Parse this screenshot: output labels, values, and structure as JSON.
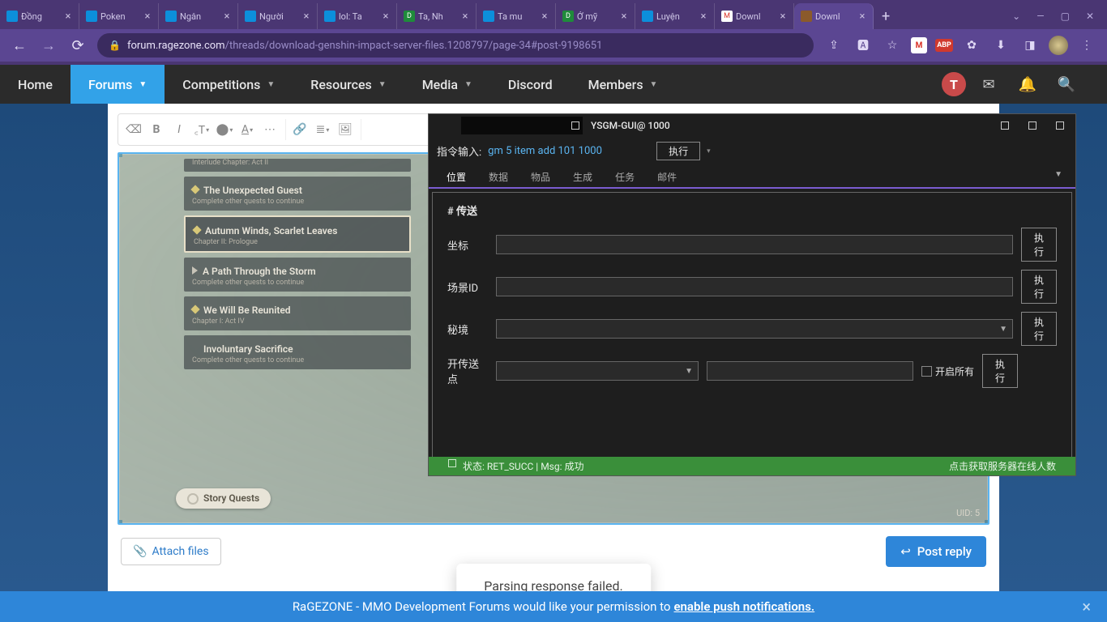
{
  "browser": {
    "tabs": [
      {
        "title": "Đồng",
        "fav": "fv-blue"
      },
      {
        "title": "Poken",
        "fav": "fv-blue"
      },
      {
        "title": "Ngân",
        "fav": "fv-blue"
      },
      {
        "title": "Người",
        "fav": "fv-blue"
      },
      {
        "title": "lol: Ta",
        "fav": "fv-blue"
      },
      {
        "title": "Ta, Nh",
        "fav": "fv-green"
      },
      {
        "title": "Ta mu",
        "fav": "fv-blue"
      },
      {
        "title": "Ở mỹ",
        "fav": "fv-green"
      },
      {
        "title": "Luyện",
        "fav": "fv-blue"
      },
      {
        "title": "Downl",
        "fav": "fv-gm"
      },
      {
        "title": "Downl",
        "fav": "fv-rz",
        "active": true
      }
    ],
    "url_domain": "forum.ragezone.com",
    "url_path": "/threads/download-genshin-impact-server-files.1208797/page-34#post-9198651"
  },
  "forum_nav": {
    "items": [
      "Home",
      "Forums",
      "Competitions",
      "Resources",
      "Media",
      "Discord",
      "Members"
    ],
    "active_index": 1,
    "user_initial": "T"
  },
  "quests": {
    "q0_title": "Interlude Chapter: Act II",
    "q1_title": "The Unexpected Guest",
    "q1_sub": "Complete other quests to continue",
    "q2_title": "Autumn Winds, Scarlet Leaves",
    "q2_sub": "Chapter II: Prologue",
    "q3_title": "A Path Through the Storm",
    "q3_sub": "Complete other quests to continue",
    "q4_title": "We Will Be Reunited",
    "q4_sub": "Chapter I: Act IV",
    "q5_title": "Involuntary Sacrifice",
    "q5_sub": "Complete other quests to continue",
    "story_label": "Story Quests",
    "uid": "UID: 5"
  },
  "actions": {
    "attach": "Attach files",
    "post_reply": "Post reply"
  },
  "toast": "Parsing response failed.",
  "notif": {
    "text": "RaGEZONE - MMO Development Forums would like your permission to ",
    "link": "enable push notifications."
  },
  "gm": {
    "title": "YSGM-GUI@ 1000",
    "cmd_label": "指令输入:",
    "cmd_value": "gm 5 item add 101 1000",
    "exec": "执行",
    "tabs": [
      "位置",
      "数据",
      "物品",
      "生成",
      "任务",
      "邮件"
    ],
    "section": "# 传送",
    "row0": "坐标",
    "row1": "场景ID",
    "row2": "秘境",
    "row3": "开传送点",
    "open_all": "开启所有",
    "status_left": "状态: RET_SUCC | Msg: 成功",
    "status_right": "点击获取服务器在线人数"
  }
}
